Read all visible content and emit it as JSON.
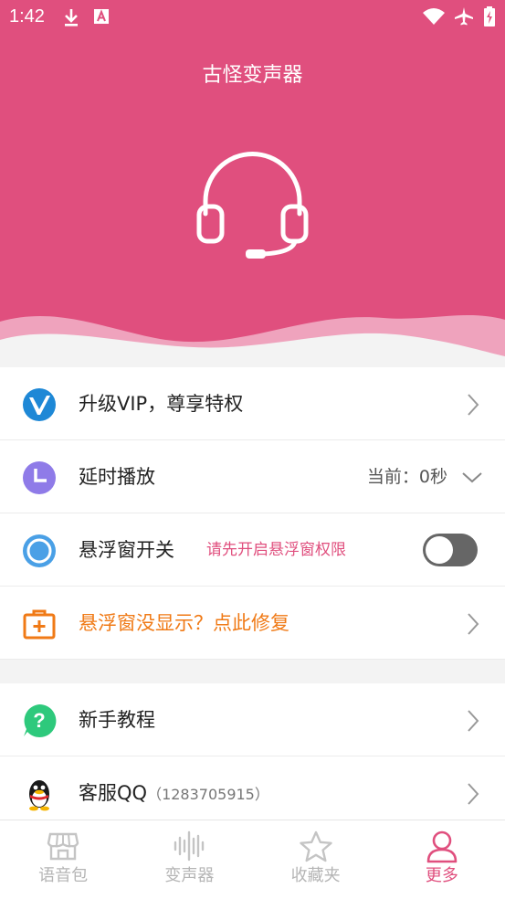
{
  "status": {
    "time": "1:42"
  },
  "app": {
    "title": "古怪变声器"
  },
  "menu": {
    "vip": {
      "label": "升级VIP，尊享特权"
    },
    "delay": {
      "label": "延时播放",
      "value": "当前：0秒"
    },
    "float_switch": {
      "label": "悬浮窗开关",
      "hint": "请先开启悬浮窗权限",
      "enabled": false
    },
    "fix": {
      "label": "悬浮窗没显示？点此修复"
    },
    "tutorial": {
      "label": "新手教程"
    },
    "service": {
      "label": "客服QQ",
      "qq": "（1283705915）"
    }
  },
  "nav": {
    "items": [
      {
        "label": "语音包",
        "icon": "shop-icon"
      },
      {
        "label": "变声器",
        "icon": "sound-wave-icon"
      },
      {
        "label": "收藏夹",
        "icon": "star-icon"
      },
      {
        "label": "更多",
        "icon": "person-icon",
        "active": true
      }
    ]
  },
  "colors": {
    "accent": "#e04f7e",
    "orange": "#f07a16"
  }
}
